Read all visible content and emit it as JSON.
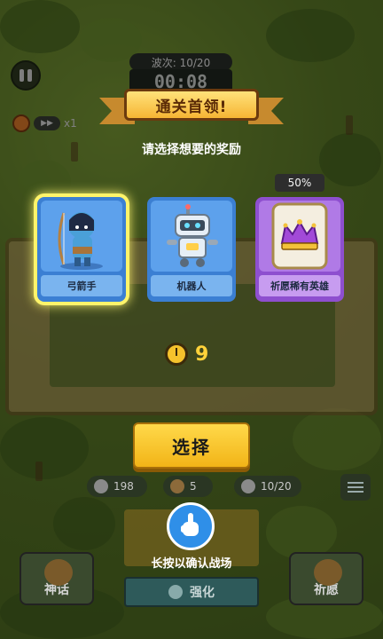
{
  "hud": {
    "wave_label": "波次: 10/20",
    "timer": "00:08",
    "speed": "x1"
  },
  "reward": {
    "banner_title": "通关首领!",
    "subtitle": "请选择想要的奖励",
    "cards": [
      {
        "label": "弓箭手",
        "selected": true
      },
      {
        "label": "机器人",
        "selected": false
      },
      {
        "label": "祈愿稀有英雄",
        "selected": false,
        "badge": "50%"
      }
    ],
    "countdown": "9",
    "select_button": "选择"
  },
  "resources": {
    "crown": "198",
    "gold": "5",
    "units": "10/20"
  },
  "bottom": {
    "myth_label": "神话",
    "wish_label": "祈愿",
    "upgrade_label": "强化",
    "hint": "长按以确认战场"
  },
  "colors": {
    "selected_glow": "#fff46a",
    "select_button": "#f2b417",
    "banner": "#f6b534"
  }
}
